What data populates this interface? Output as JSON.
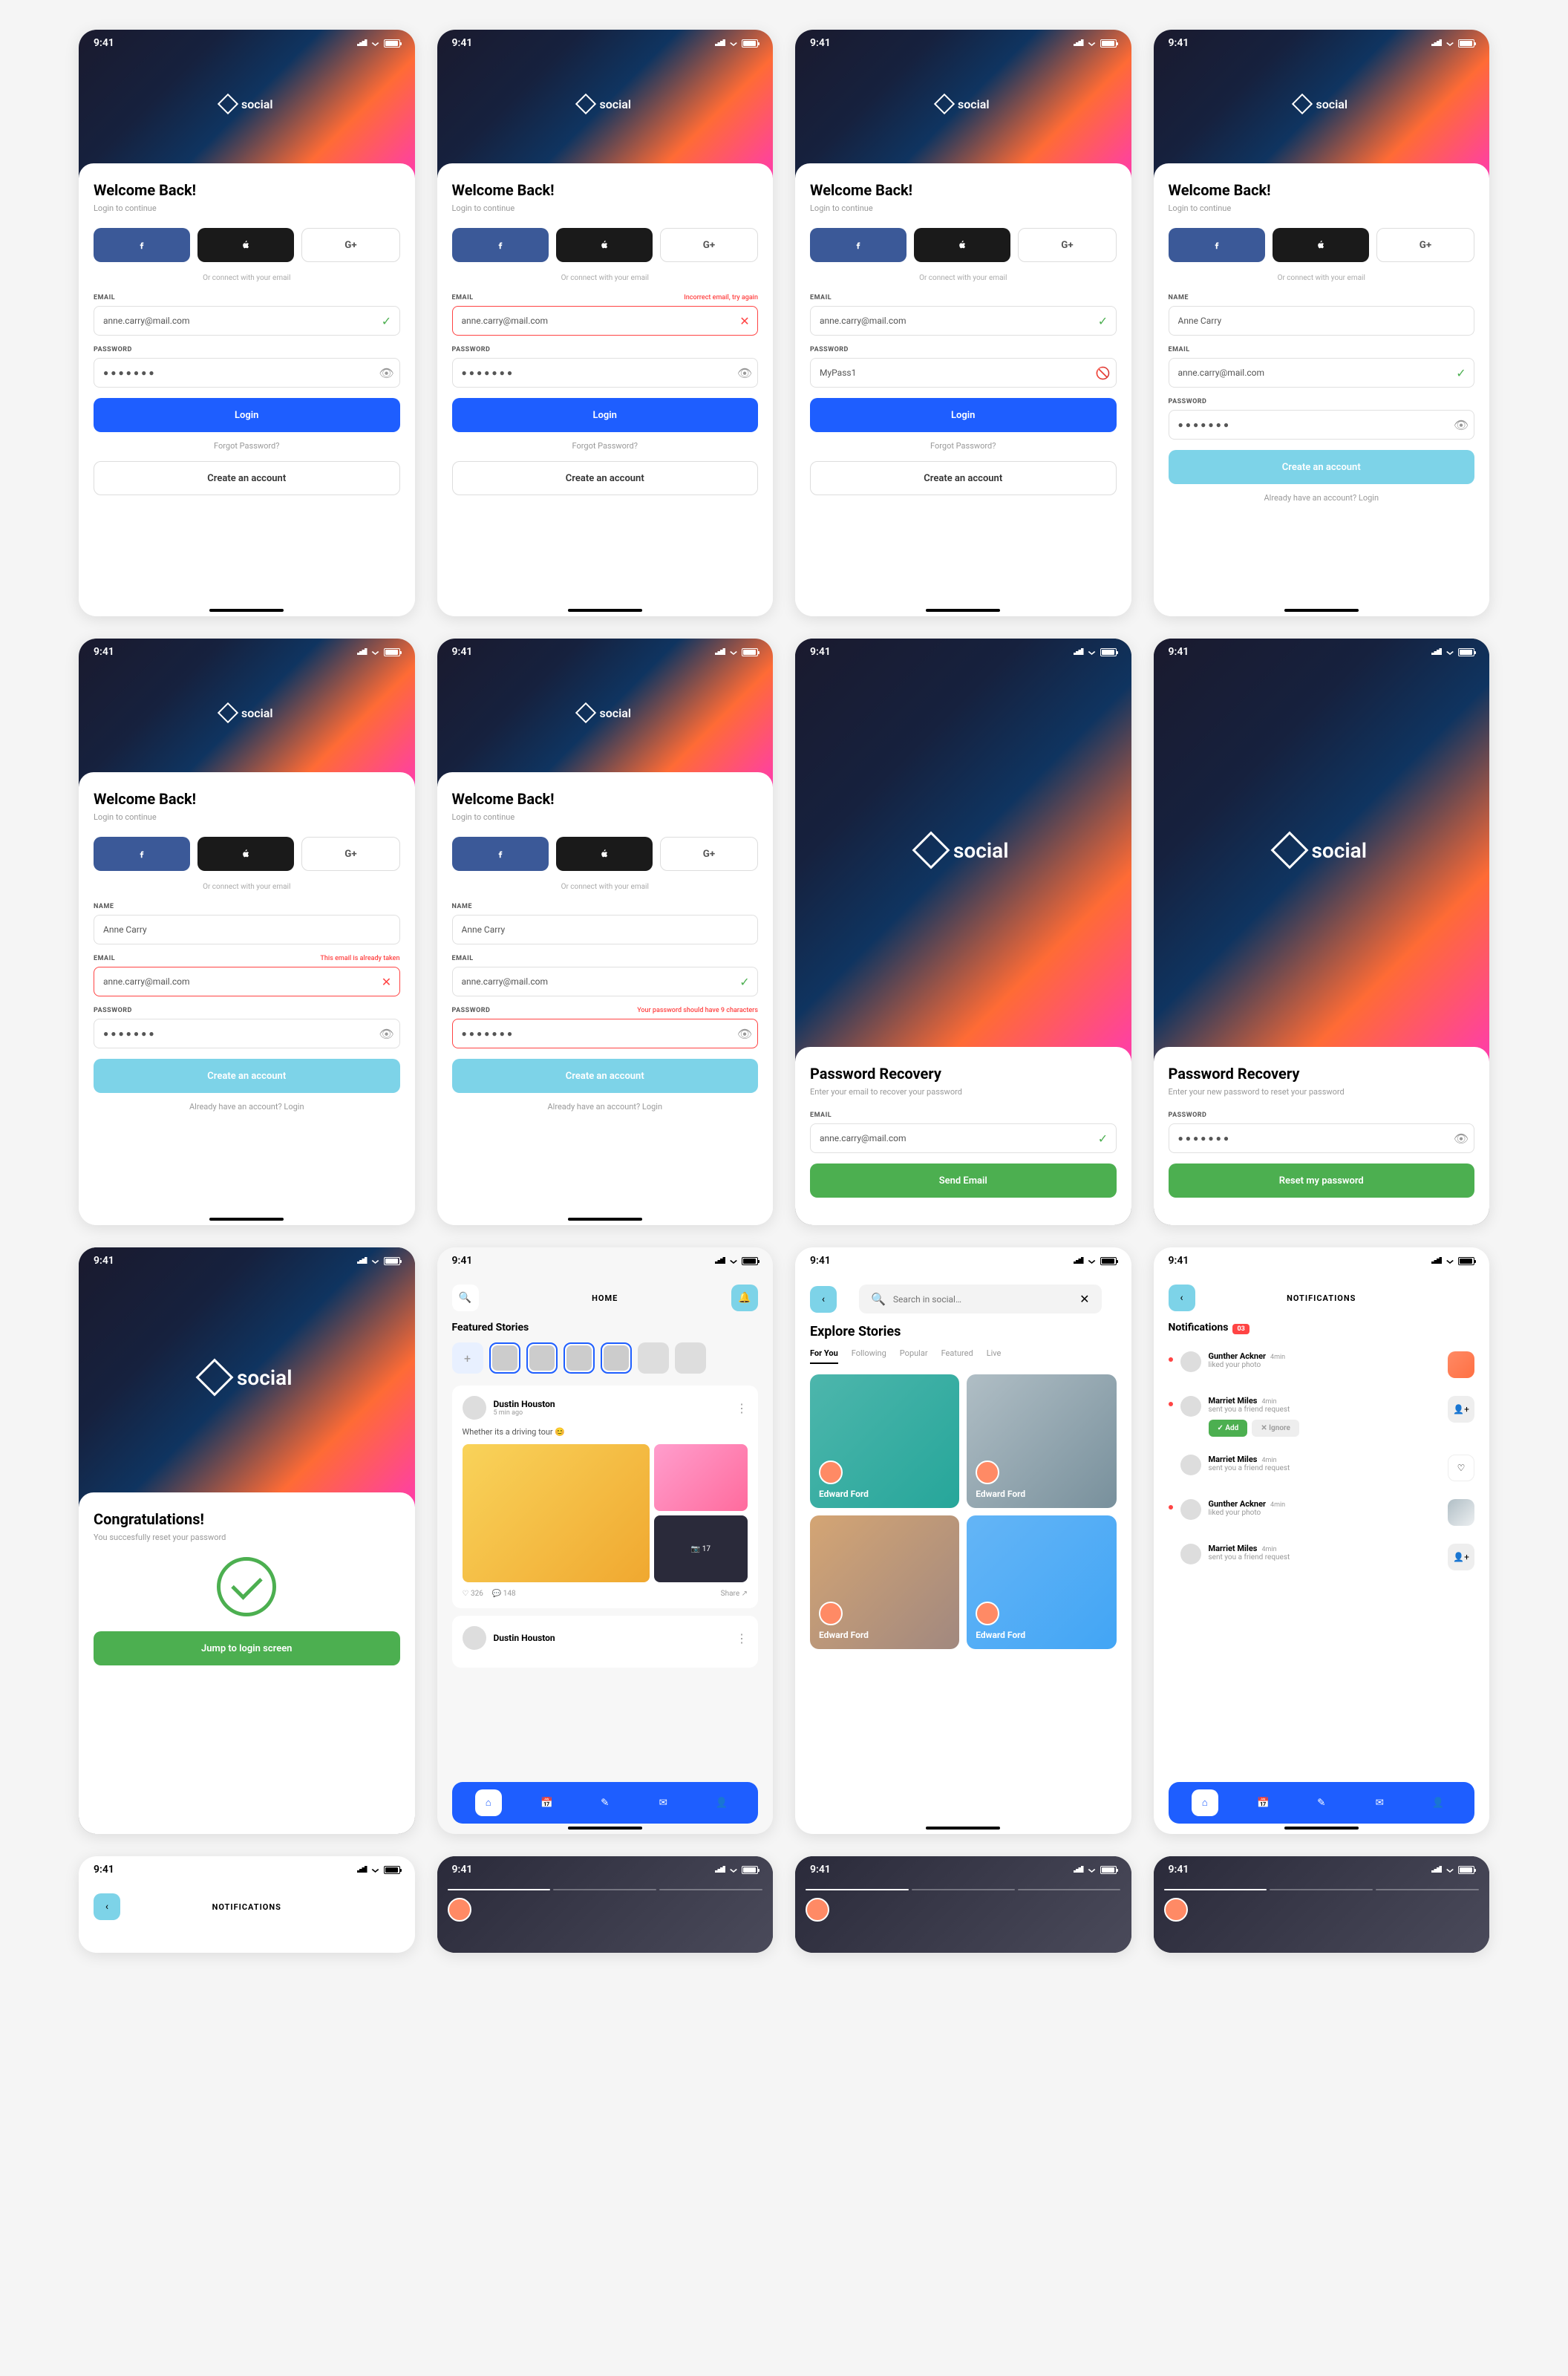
{
  "status": {
    "time": "9:41"
  },
  "brand": "social",
  "login": {
    "title": "Welcome Back!",
    "subtitle": "Login to continue",
    "divider": "Or connect with your email",
    "email_label": "EMAIL",
    "email_value": "anne.carry@mail.com",
    "password_label": "PASSWORD",
    "password_dots": "● ● ● ● ● ● ●",
    "password_visible": "MyPass1",
    "login_btn": "Login",
    "forgot": "Forgot Password?",
    "create": "Create an account",
    "error_email": "Incorrect email, try again",
    "name_label": "NAME",
    "name_value": "Anne Carry",
    "has_account": "Already have an account? Login",
    "email_taken": "This email is already taken",
    "pw_short": "Your password should have 9 characters"
  },
  "recovery": {
    "title": "Password Recovery",
    "sub1": "Enter your email to recover your password",
    "sub2": "Enter your new password to reset your password",
    "send": "Send Email",
    "reset": "Reset my password"
  },
  "congrats": {
    "title": "Congratulations!",
    "sub": "You succesfully reset your password",
    "btn": "Jump to login screen"
  },
  "home": {
    "title": "HOME",
    "featured": "Featured Stories",
    "post_author": "Dustin Houston",
    "post_time": "5 min ago",
    "post_body": "Whether its a driving tour 😊",
    "photo_count": "📷 17",
    "likes": "326",
    "comments": "148",
    "share": "Share"
  },
  "explore": {
    "title": "Explore Stories",
    "search_placeholder": "Search in social…",
    "tabs": [
      "For You",
      "Following",
      "Popular",
      "Featured",
      "Live"
    ],
    "user": "Edward Ford"
  },
  "notif": {
    "title": "NOTIFICATIONS",
    "heading": "Notifications",
    "count": "03",
    "n1_name": "Gunther Ackner",
    "n1_time": "4min",
    "n1_text": "liked your photo",
    "n2_name": "Marriet Miles",
    "n2_time": "4min",
    "n2_text": "sent you a friend request",
    "add": "✓ Add",
    "ignore": "✕ Ignore",
    "n3_name": "Marriet Miles",
    "n3_time": "4min",
    "n3_text": "sent you a friend request",
    "n4_name": "Gunther Ackner",
    "n4_time": "4min",
    "n4_text": "liked your photo",
    "n5_name": "Marriet Miles",
    "n5_time": "4min",
    "n5_text": "sent you a friend request"
  }
}
